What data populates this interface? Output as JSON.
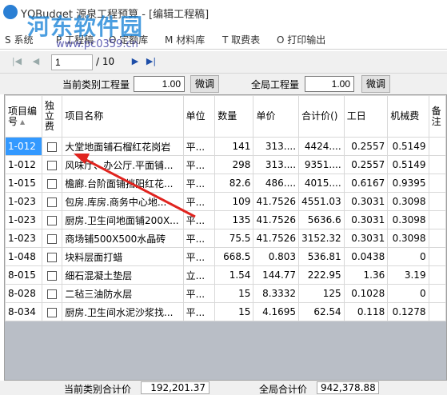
{
  "window": {
    "title": "YQBudget 源泉工程预算 - [编辑工程稿]"
  },
  "watermark": {
    "title": "河东软件园",
    "url": "www.pc0359.cn"
  },
  "menu": [
    {
      "key": "S",
      "label": "系统"
    },
    {
      "key": "P",
      "label": "工程稿"
    },
    {
      "key": "O",
      "label": "定额库"
    },
    {
      "key": "M",
      "label": "材料库"
    },
    {
      "key": "T",
      "label": "取费表"
    },
    {
      "key": "O",
      "label": "打印输出"
    }
  ],
  "nav": {
    "page": "1",
    "total": "/ 10"
  },
  "quantity": {
    "current_label": "当前类别工程量",
    "current_value": "1.00",
    "adjust_label": "微调",
    "global_label": "全局工程量",
    "global_value": "1.00",
    "global_adjust_label": "微调"
  },
  "table": {
    "headers": [
      "项目编号",
      "独立费",
      "项目名称",
      "单位",
      "数量",
      "单价",
      "合计价()",
      "工日",
      "机械费",
      "备注"
    ],
    "rows": [
      {
        "code": "1-012",
        "name": "大堂地面铺石榴红花岗岩",
        "unit": "平...",
        "qty": "141",
        "price": "313....",
        "total": "4424....",
        "labor": "0.2557",
        "machine": "0.5149"
      },
      {
        "code": "1-012",
        "name": "风味厅、办公厅.平面铺...",
        "unit": "平...",
        "qty": "298",
        "price": "313....",
        "total": "9351....",
        "labor": "0.2557",
        "machine": "0.5149"
      },
      {
        "code": "1-015",
        "name": "檐廊.台阶面铺挡阳红花...",
        "unit": "平...",
        "qty": "82.6",
        "price": "486....",
        "total": "4015....",
        "labor": "0.6167",
        "machine": "0.9395"
      },
      {
        "code": "1-023",
        "name": "包房.库房.商务中心地...",
        "unit": "平...",
        "qty": "109",
        "price": "41.7526",
        "total": "4551.03",
        "labor": "0.3031",
        "machine": "0.3098"
      },
      {
        "code": "1-023",
        "name": "厨房.卫生间地面铺200X...",
        "unit": "平...",
        "qty": "135",
        "price": "41.7526",
        "total": "5636.6",
        "labor": "0.3031",
        "machine": "0.3098"
      },
      {
        "code": "1-023",
        "name": "商场铺500X500水晶砖",
        "unit": "平...",
        "qty": "75.5",
        "price": "41.7526",
        "total": "3152.32",
        "labor": "0.3031",
        "machine": "0.3098"
      },
      {
        "code": "1-048",
        "name": "块料层面打蜡",
        "unit": "平...",
        "qty": "668.5",
        "price": "0.803",
        "total": "536.81",
        "labor": "0.0438",
        "machine": "0"
      },
      {
        "code": "8-015",
        "name": "细石混凝土垫层",
        "unit": "立...",
        "qty": "1.54",
        "price": "144.77",
        "total": "222.95",
        "labor": "1.36",
        "machine": "3.19"
      },
      {
        "code": "8-028",
        "name": "二毡三油防水层",
        "unit": "平...",
        "qty": "15",
        "price": "8.3332",
        "total": "125",
        "labor": "0.1028",
        "machine": "0"
      },
      {
        "code": "8-034",
        "name": "厨房.卫生间水泥沙浆找...",
        "unit": "平...",
        "qty": "15",
        "price": "4.1695",
        "total": "62.54",
        "labor": "0.118",
        "machine": "0.1278"
      }
    ]
  },
  "footer": {
    "current_label": "当前类别合计价",
    "current_total": "192,201.37",
    "global_label": "全局合计价",
    "global_total": "942,378.88"
  },
  "colors": {
    "selection": "#3399ff",
    "annotation_arrow": "#e0241f",
    "watermark": "#1f86d9"
  }
}
